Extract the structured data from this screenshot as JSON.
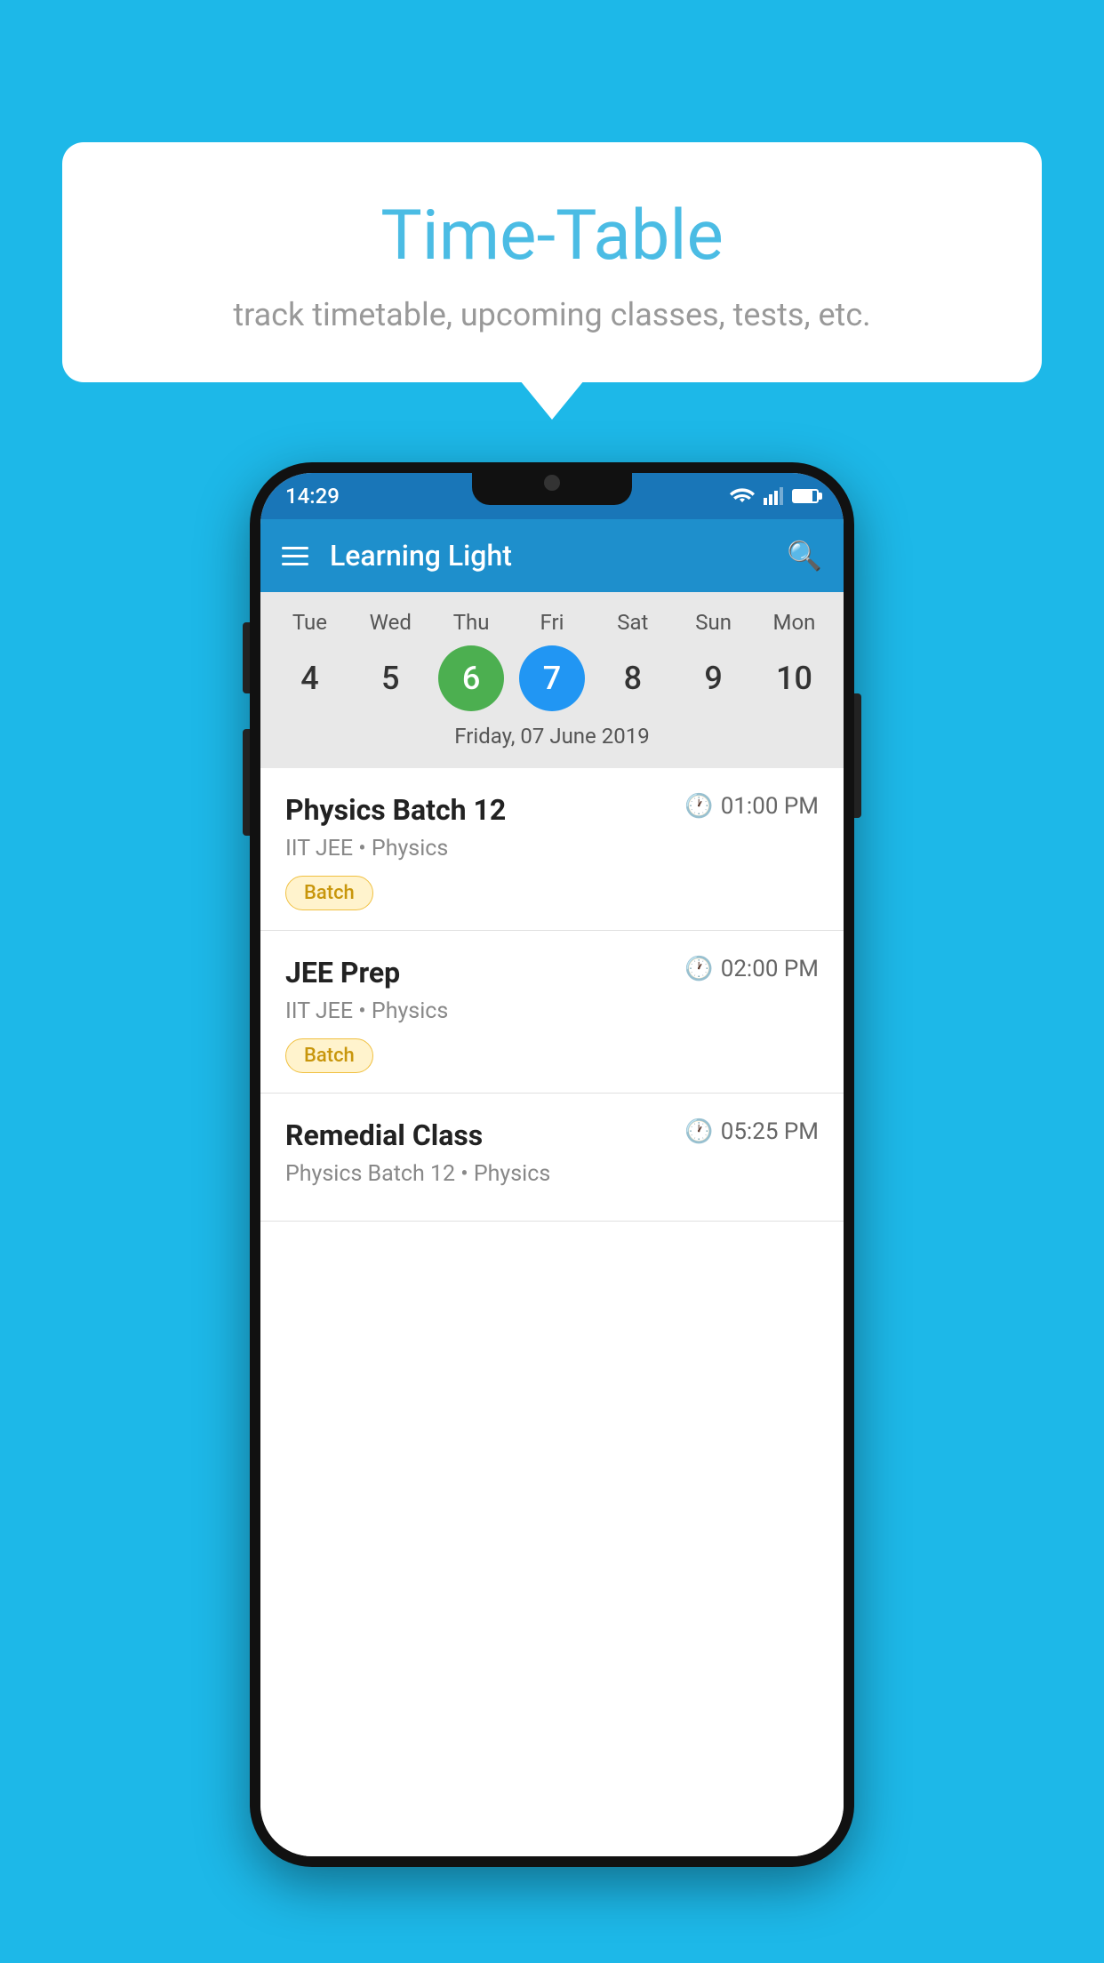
{
  "background_color": "#1DB8E8",
  "speech_bubble": {
    "title": "Time-Table",
    "subtitle": "track timetable, upcoming classes, tests, etc."
  },
  "phone": {
    "status_bar": {
      "time": "14:29"
    },
    "app_bar": {
      "title": "Learning Light"
    },
    "calendar": {
      "days": [
        {
          "label": "Tue",
          "num": "4"
        },
        {
          "label": "Wed",
          "num": "5"
        },
        {
          "label": "Thu",
          "num": "6",
          "state": "today"
        },
        {
          "label": "Fri",
          "num": "7",
          "state": "selected"
        },
        {
          "label": "Sat",
          "num": "8"
        },
        {
          "label": "Sun",
          "num": "9"
        },
        {
          "label": "Mon",
          "num": "10"
        }
      ],
      "selected_date": "Friday, 07 June 2019"
    },
    "schedule": [
      {
        "title": "Physics Batch 12",
        "time": "01:00 PM",
        "subtitle": "IIT JEE • Physics",
        "badge": "Batch"
      },
      {
        "title": "JEE Prep",
        "time": "02:00 PM",
        "subtitle": "IIT JEE • Physics",
        "badge": "Batch"
      },
      {
        "title": "Remedial Class",
        "time": "05:25 PM",
        "subtitle": "Physics Batch 12 • Physics",
        "badge": null
      }
    ]
  }
}
